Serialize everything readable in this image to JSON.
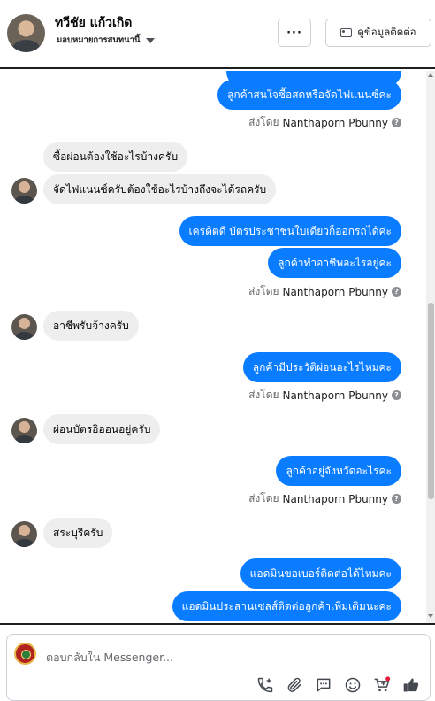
{
  "header": {
    "name": "ทวีชัย แก้วเกิด",
    "subtitle": "มอบหมายการสนทนานี้",
    "contact_button": "ดูข้อมูลติดต่อ",
    "more_button": "···"
  },
  "thread": {
    "messages": {
      "m1": "ลูกค้าสนใจซื้อสดหรือจัดไฟแนนซ์คะ",
      "s1": "ส่งโดย",
      "s1_who": "Nanthaporn Pbunny",
      "m2": "ซื้อผ่อนต้องใช้อะไรบ้างครับ",
      "m3": "จัดไฟแนนซ์ครับต้องใช้อะไรบ้างถึงจะได้รถครับ",
      "m4": "เครดิตดี บัตรประชาชนใบเดียวก็ออกรถได้ค่ะ",
      "m5": "ลูกค้าทำอาชีพอะไรอยู่คะ",
      "s2": "ส่งโดย",
      "s2_who": "Nanthaporn Pbunny",
      "m6": "อาชีพรับจ้างครับ",
      "m7": "ลูกค้ามีประวัติผ่อนอะไรไหมคะ",
      "s3": "ส่งโดย",
      "s3_who": "Nanthaporn Pbunny",
      "m8": "ผ่อนบัตรอิออนอยู่ครับ",
      "m9": "ลูกค้าอยู่จังหวัดอะไรคะ",
      "s4": "ส่งโดย",
      "s4_who": "Nanthaporn Pbunny",
      "m10": "สระบุรีครับ",
      "m11": "แอดมินขอเบอร์ติดต่อได้ไหมคะ",
      "m12": "แอดมินประสานเซลส์ติดต่อลูกค้าเพิ่มเติมนะคะ"
    }
  },
  "composer": {
    "placeholder": "ตอบกลับใน Messenger..."
  },
  "colors": {
    "outgoing_bubble": "#0a7cff",
    "incoming_bubble": "#eeeeee",
    "notification_dot": "#e41e3f"
  },
  "icons": [
    "phone-add-icon",
    "paperclip-icon",
    "chat-bubble-icon",
    "emoji-icon",
    "cart-icon",
    "thumbs-up-icon",
    "help-icon",
    "id-card-icon",
    "caret-down-icon"
  ]
}
